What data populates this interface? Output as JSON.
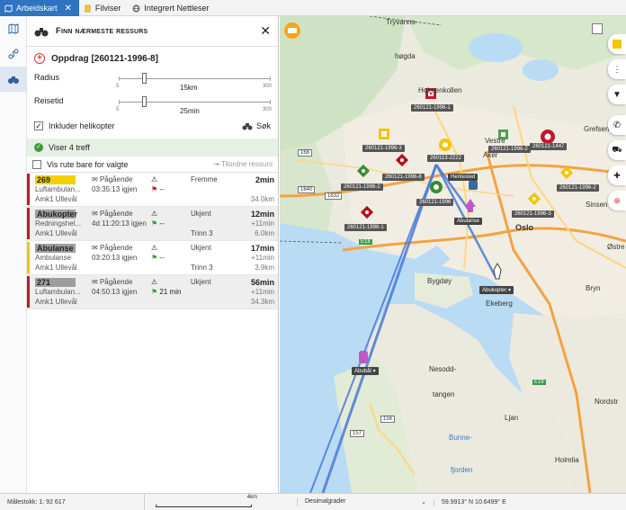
{
  "tabs": [
    {
      "label": "Arbeidskart",
      "active": true,
      "icon": "map-icon"
    },
    {
      "label": "Filviser",
      "active": false,
      "icon": "file-icon"
    },
    {
      "label": "Integrert Nettleser",
      "active": false,
      "icon": "globe-icon"
    }
  ],
  "rail": [
    {
      "icon": "map-layers-icon",
      "active": false
    },
    {
      "icon": "route-icon",
      "active": false
    },
    {
      "icon": "binoculars-icon",
      "active": true
    }
  ],
  "panel": {
    "title": "Finn nærmeste ressurs",
    "mission": "Oppdrag [260121-1996-8]",
    "radius": {
      "label": "Radius",
      "min": "5",
      "max": "300",
      "value": "15km",
      "fraction": 0.034
    },
    "reisetid": {
      "label": "Reisetid",
      "min": "5",
      "max": "300",
      "value": "25min",
      "fraction": 0.068
    },
    "include_heli": {
      "label": "Inkluder helikopter",
      "checked": true
    },
    "search_label": "Søk",
    "hits": "Viser 4 treff",
    "route_only": "Vis rute bare for valgte",
    "reorder": "Tilordne ressurs"
  },
  "resources": [
    {
      "name": "269",
      "name_bg": "#f5d000",
      "bar": "#c0182a",
      "type": "Luftambulan...",
      "base": "Amk1 Ullevål",
      "status": "Pågående",
      "time_ago": "03:35:13 igjen",
      "alert2": "--",
      "dest": "Fremme",
      "trinn": "",
      "t1": "2min",
      "t2": "",
      "t3": "34.0km"
    },
    {
      "name": "Abukopter",
      "name_bg": "#9e9e9e",
      "bar": "#c0182a",
      "type": "Redningshel...",
      "base": "Amk1 Ullevål",
      "status": "Pågående",
      "time_ago": "4d 11:20:13 igjen",
      "alert2": "--",
      "dest": "Ukjent",
      "trinn": "Trinn 3",
      "t1": "12min",
      "t2": "+11min",
      "t3": "6.0km"
    },
    {
      "name": "Abulanse",
      "name_bg": "#9e9e9e",
      "bar": "#f5c400",
      "type": "Ambulanse",
      "base": "Amk1 Ullevål",
      "status": "Pågående",
      "time_ago": "03:20:13 igjen",
      "alert2": "--",
      "dest": "Ukjent",
      "trinn": "Trinn 3",
      "t1": "17min",
      "t2": "+11min",
      "t3": "3.9km"
    },
    {
      "name": "271",
      "name_bg": "#9e9e9e",
      "bar": "#c0182a",
      "type": "Luftambulan...",
      "base": "Amk1 Ullevål",
      "status": "Pågående",
      "time_ago": "04:50:13 igjen",
      "alert2": "21 min",
      "dest": "Ukjent",
      "trinn": "",
      "t1": "56min",
      "t2": "+11min",
      "t3": "34.3km"
    }
  ],
  "map": {
    "places": [
      "Tryvanns-",
      "høgda",
      "Holmenkollen",
      "Vestre",
      "Aker",
      "Oslo",
      "Bygdøy",
      "Ekeberg",
      "Bryn",
      "Nesodd-",
      "tangen",
      "Ljan",
      "Bunne-",
      "fjorden",
      "Holmlia",
      "Grefsen",
      "Sinsen",
      "Østre",
      "Nordstr"
    ],
    "road_numbers": [
      "168",
      "1640",
      "1632",
      "156",
      "157",
      "E18",
      "E16"
    ],
    "markers": [
      "260121-1996-1",
      "260121-1996-3",
      "260121-1996-8",
      "260113-2222",
      "260121-1996-2",
      "260121-1447",
      "260121-1996-2",
      "260121-1996",
      "260121-1996-2",
      "260121-1996-3",
      "260121-1996-1"
    ],
    "vehicle_labels": [
      "Hentested",
      "Abulanse",
      "Abukopter ▾",
      "Abubåt ▾"
    ]
  },
  "statusbar": {
    "scale": "Målestokk: 1: 92 617",
    "ruler_km": "4km",
    "coord_type": "Desimalgrader",
    "coords": "59.9913° N 10.6499° E"
  }
}
